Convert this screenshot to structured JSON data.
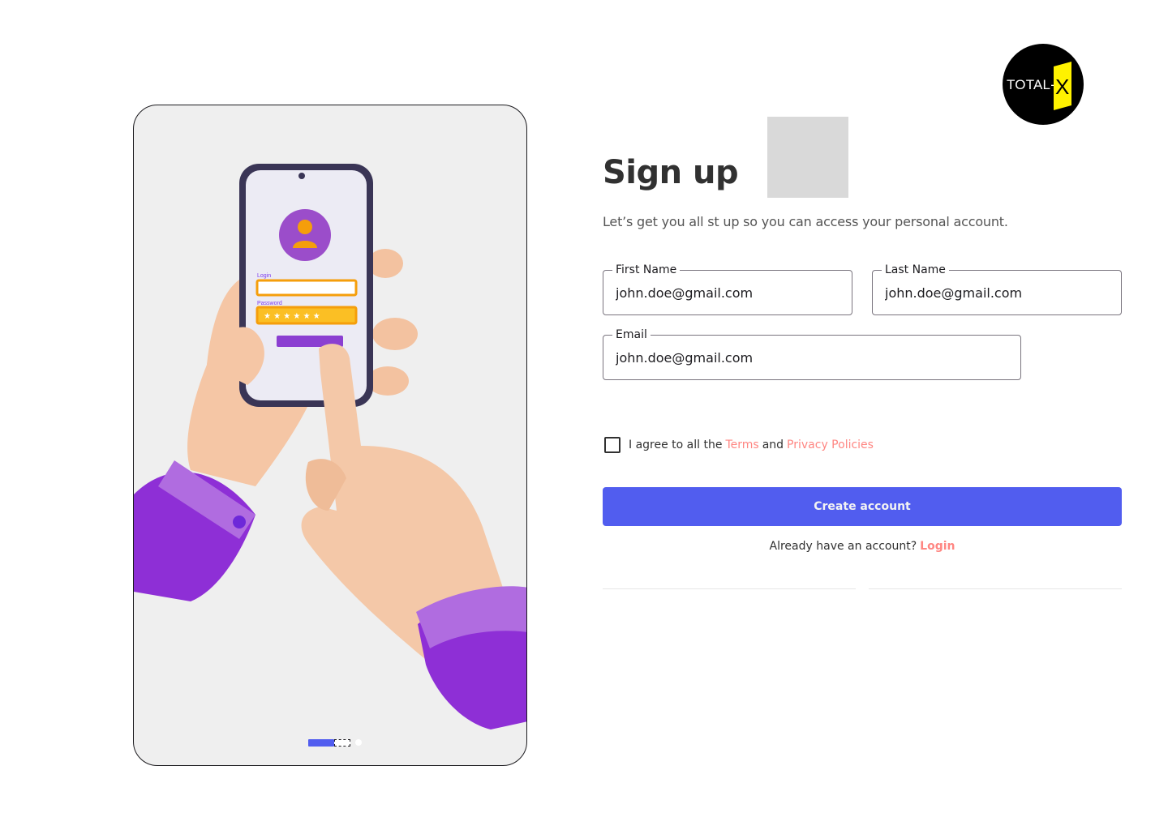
{
  "logo": {
    "text": "TOTAL-",
    "mark": "X"
  },
  "header": {
    "title": "Sign up",
    "subtitle": "Let’s get you all st up so you can access your personal account."
  },
  "form": {
    "first_name": {
      "label": "First Name",
      "value": "john.doe@gmail.com"
    },
    "last_name": {
      "label": "Last Name",
      "value": "john.doe@gmail.com"
    },
    "email": {
      "label": "Email",
      "value": "john.doe@gmail.com"
    }
  },
  "agree": {
    "prefix": "I agree to all the",
    "terms": "Terms",
    "and": "and",
    "privacy": "Privacy Policies",
    "checked": false
  },
  "create_button": "Create account",
  "login_prompt": {
    "text": "Already have an account?",
    "link": "Login"
  },
  "illustration": {
    "phone_login_label": "Login",
    "phone_password_label": "Password"
  },
  "carousel": {
    "slides": 3,
    "active": 0
  },
  "colors": {
    "primary": "#515def",
    "link": "#ff8682",
    "logo_bg": "#000000",
    "logo_accent": "#fff200"
  }
}
